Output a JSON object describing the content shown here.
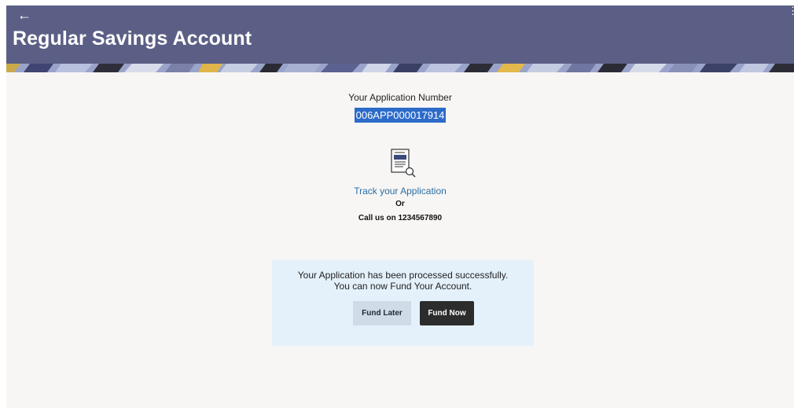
{
  "header": {
    "back_glyph": "←",
    "menu_glyph": "⋮",
    "title": "Regular Savings Account",
    "color": "#5c5f85"
  },
  "application": {
    "label": "Your Application Number",
    "number": "006APP000017914",
    "highlight_color": "#2d6bc9"
  },
  "tracking": {
    "icon": "document-search-icon",
    "link_label": "Track your Application",
    "or_label": "Or",
    "call_label": "Call us on 1234567890"
  },
  "status_panel": {
    "message_line1": "Your Application has been processed successfully.",
    "message_line2": "You can now Fund Your Account.",
    "fund_later_label": "Fund Later",
    "fund_now_label": "Fund Now",
    "background": "#e4f1fb"
  }
}
